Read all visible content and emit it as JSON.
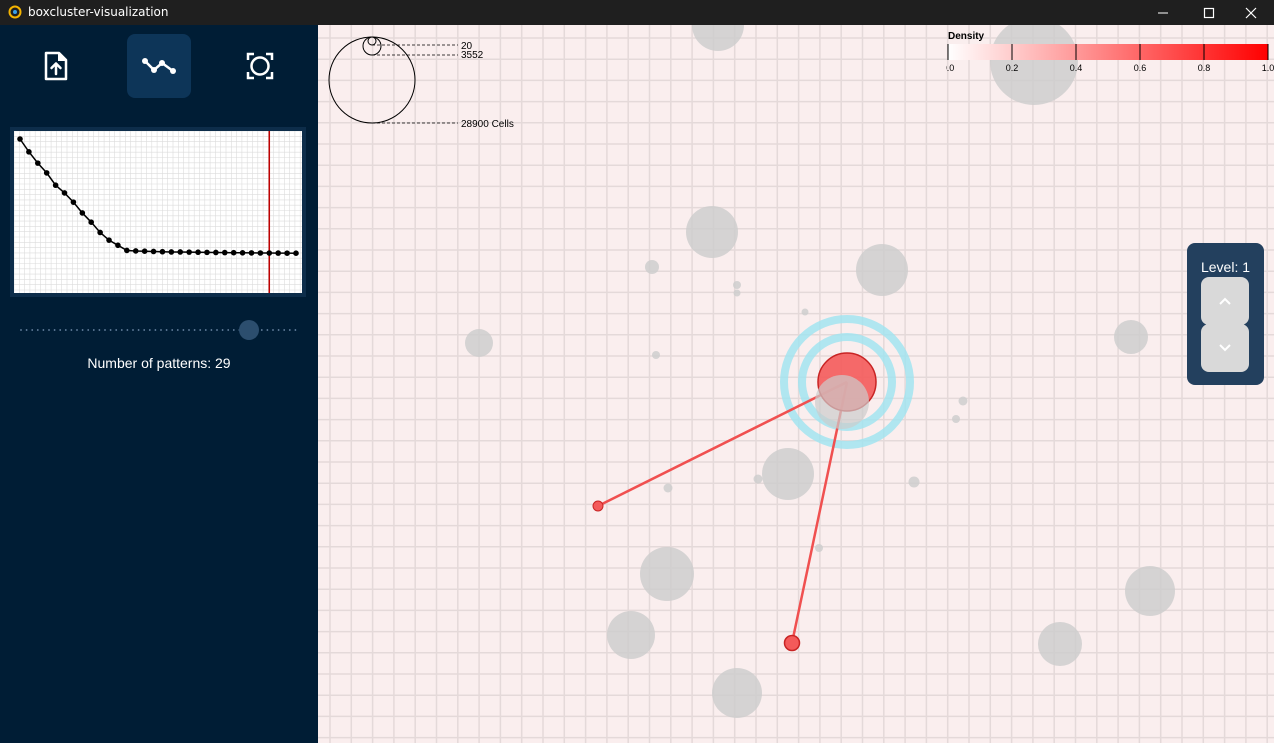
{
  "window": {
    "title": "boxcluster-visualization",
    "controls": [
      "minimize",
      "maximize",
      "close"
    ]
  },
  "toolbar": {
    "buttons": [
      {
        "name": "upload-file",
        "icon": "file-upload-icon",
        "active": false
      },
      {
        "name": "elbow-chart",
        "icon": "line-chart-icon",
        "active": true
      },
      {
        "name": "focus",
        "icon": "focus-frame-icon",
        "active": false
      }
    ]
  },
  "elbow_chart": {
    "values": [
      29,
      26.5,
      24.3,
      22.4,
      20,
      18.5,
      16.7,
      14.6,
      12.8,
      10.8,
      9.3,
      8.3,
      7.3,
      7.2,
      7.15,
      7.1,
      7.05,
      7.0,
      7.0,
      6.97,
      6.95,
      6.92,
      6.9,
      6.88,
      6.86,
      6.84,
      6.82,
      6.8,
      6.79,
      6.78,
      6.77,
      6.76
    ],
    "selected_index": 28,
    "line_color": "#000000",
    "marker_color": "#c00000"
  },
  "slider": {
    "value": 29
  },
  "patterns_label": "Number of patterns: 29",
  "size_legend": {
    "labels": [
      "20",
      "3552",
      "28900 Cells"
    ]
  },
  "density_legend": {
    "title": "Density",
    "ticks": [
      "0.0",
      "0.2",
      "0.4",
      "0.6",
      "0.8",
      "1.0"
    ],
    "color_low": "#ffffff",
    "color_high": "#ff0000"
  },
  "level": {
    "label": "Level: 1"
  },
  "colors": {
    "sidebar_bg": "#001d35",
    "canvas_bg": "#faeeee",
    "grid_line": "#e4d9d9",
    "cluster_gray": "#cccccc",
    "highlight": "#f05050",
    "halo": "#9ee4f0"
  }
}
